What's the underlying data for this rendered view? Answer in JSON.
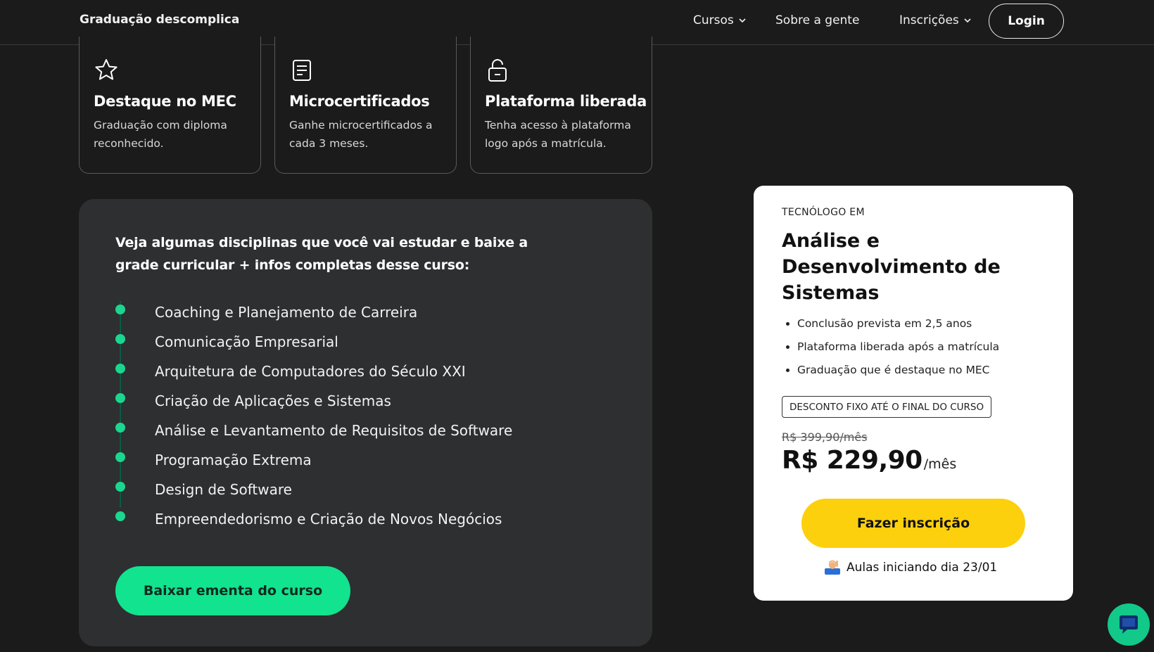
{
  "header": {
    "brand": "Graduação descomplica",
    "nav": {
      "courses": "Cursos",
      "about": "Sobre a gente",
      "enrollments": "Inscrições"
    },
    "login_label": "Login"
  },
  "features": [
    {
      "icon": "star-icon",
      "title": "Destaque no MEC",
      "description": "Graduação com diploma reconhecido."
    },
    {
      "icon": "document-icon",
      "title": "Microcertificados",
      "description": "Ganhe microcertificados a cada 3 meses."
    },
    {
      "icon": "unlock-icon",
      "title": "Plataforma liberada",
      "description": "Tenha acesso à plataforma logo após a matrícula."
    }
  ],
  "curriculum": {
    "intro": "Veja algumas disciplinas que você vai estudar e baixe a grade curricular + infos completas desse curso:",
    "subjects": [
      "Coaching e Planejamento de Carreira",
      "Comunicação Empresarial",
      "Arquitetura de Computadores do Século XXI",
      "Criação de Aplicações e Sistemas",
      "Análise e Levantamento de Requisitos de Software",
      "Programação Extrema",
      "Design de Software",
      "Empreendedorismo e Criação de Novos Negócios"
    ],
    "download_label": "Baixar ementa do curso"
  },
  "price_card": {
    "kicker": "TECNÓLOGO EM",
    "course_name": "Análise e Desenvolvimento de Sistemas",
    "bullets": [
      "Conclusão prevista em 2,5 anos",
      "Plataforma liberada após a matrícula",
      "Graduação que é destaque no MEC"
    ],
    "discount_badge": "DESCONTO FIXO ATÉ O FINAL DO CURSO",
    "old_price": "R$ 399,90/mês",
    "new_price": "R$ 229,90",
    "per_month": "/mês",
    "enroll_label": "Fazer inscrição",
    "start_note": "Aulas iniciando dia 23/01"
  },
  "colors": {
    "background": "#1b1b1b",
    "panel": "#2e2f31",
    "accent_green": "#12e38e",
    "accent_yellow": "#fcd00c"
  }
}
